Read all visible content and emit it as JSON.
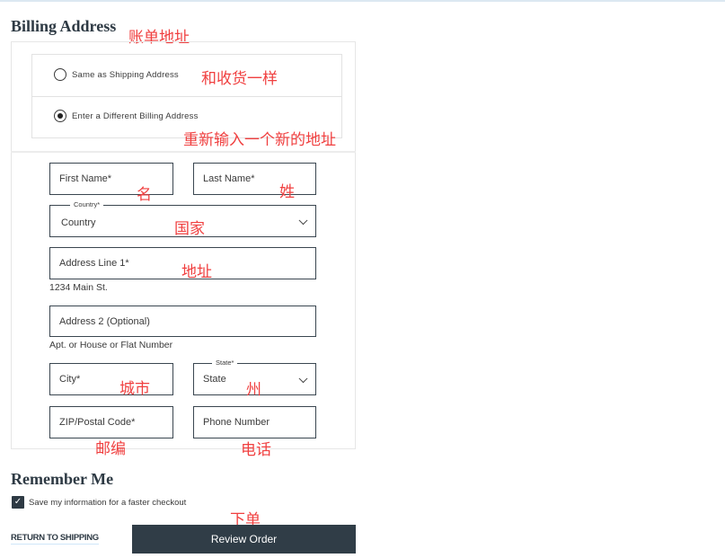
{
  "billing": {
    "title": "Billing Address",
    "options": [
      {
        "label": "Same as Shipping Address",
        "selected": false
      },
      {
        "label": "Enter a Different Billing Address",
        "selected": true
      }
    ]
  },
  "form": {
    "first_name": {
      "placeholder": "First Name*"
    },
    "last_name": {
      "placeholder": "Last Name*"
    },
    "country": {
      "legend": "Country*",
      "value": "Country"
    },
    "address1": {
      "placeholder": "Address Line 1*",
      "helper": "1234 Main St."
    },
    "address2": {
      "placeholder": "Address 2 (Optional)",
      "helper": "Apt. or House or Flat Number"
    },
    "city": {
      "placeholder": "City*"
    },
    "state": {
      "legend": "State*",
      "value": "State"
    },
    "zip": {
      "placeholder": "ZIP/Postal Code*"
    },
    "phone": {
      "placeholder": "Phone Number"
    }
  },
  "remember": {
    "title": "Remember Me",
    "checkbox_label": "Save my information for a faster checkout",
    "checked": true,
    "check_glyph": "✓"
  },
  "actions": {
    "return_label": "RETURN TO SHIPPING",
    "review_label": "Review Order"
  },
  "annotations": {
    "billing_address": "账单地址",
    "same_as_shipping": "和收货一样",
    "new_address": "重新输入一个新的地址",
    "first_name": "名",
    "last_name": "姓",
    "country": "国家",
    "address": "地址",
    "city": "城市",
    "state": "州",
    "zip": "邮编",
    "phone": "电话",
    "place_order": "下单"
  },
  "colors": {
    "accent_dark": "#303d47",
    "annotation_red": "#f04040",
    "link_underline": "#cfe6f8"
  }
}
